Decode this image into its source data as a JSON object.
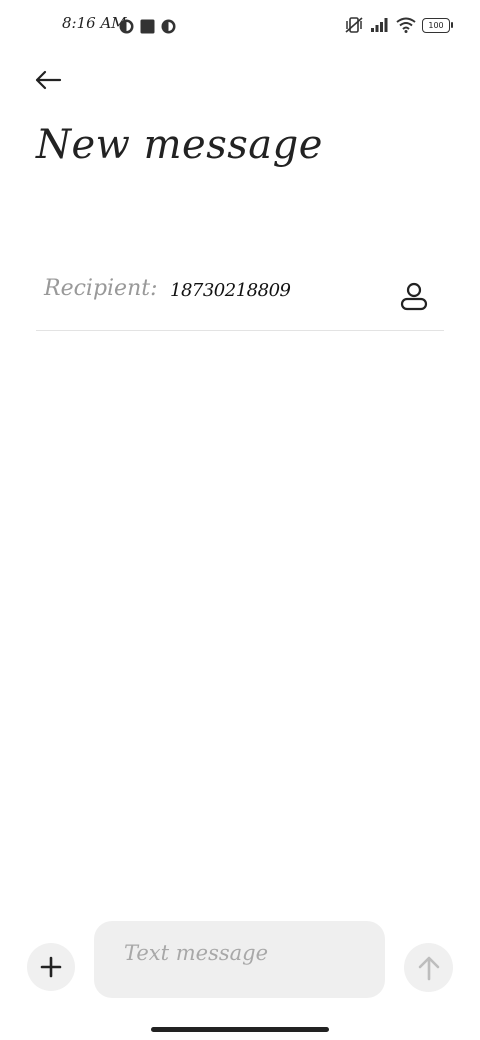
{
  "status_bar": {
    "time": "8:16 AM",
    "left_icons": [
      "app-notification-icon",
      "square-notification-icon",
      "app-notification-icon"
    ],
    "right_icons": [
      "vibrate-off-icon",
      "signal-icon",
      "wifi-icon",
      "battery-icon"
    ],
    "battery_level": "100"
  },
  "header": {
    "back_icon": "arrow-left-icon",
    "title": "New message"
  },
  "recipient": {
    "label": "Recipient:",
    "value": "18730218809",
    "contact_icon": "person-icon"
  },
  "composer": {
    "attach_icon": "plus-icon",
    "placeholder": "Text message",
    "send_icon": "arrow-up-icon"
  },
  "colors": {
    "background": "#ffffff",
    "input_bg": "#efefef",
    "placeholder": "#a8a8a8",
    "label": "#999999",
    "divider": "#e3e3e3"
  }
}
